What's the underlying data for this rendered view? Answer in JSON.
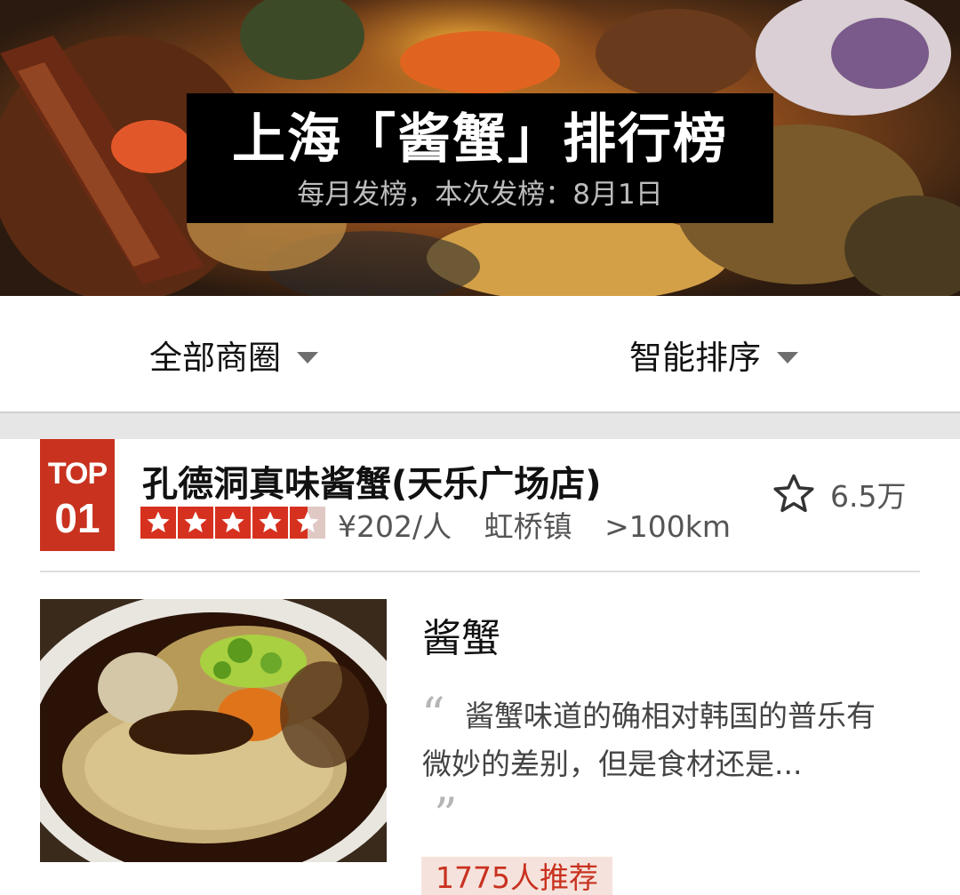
{
  "banner": {
    "title": "上海「酱蟹」排行榜",
    "subtitle": "每月发榜，本次发榜：8月1日"
  },
  "filters": {
    "area": {
      "label": "全部商圈",
      "icon": "caret-down-icon"
    },
    "sort": {
      "label": "智能排序",
      "icon": "caret-down-icon"
    }
  },
  "shop": {
    "rank_prefix": "TOP",
    "rank_number": "01",
    "name": "孔德洞真味酱蟹(天乐广场店)",
    "rating_stars": 4.5,
    "price": "¥202/人",
    "district": "虹桥镇",
    "distance": ">100km",
    "favorite_icon": "star-outline-icon",
    "favorite_count": "6.5万",
    "dish": {
      "name": "酱蟹",
      "review": "酱蟹味道的确相对韩国的普乐有微妙的差别，但是食材还是...",
      "quote_open": "“",
      "quote_close": "”",
      "recommend": "1775人推荐"
    }
  },
  "colors": {
    "brand_red": "#c8321f",
    "badge_bg": "#f6e2dc"
  }
}
